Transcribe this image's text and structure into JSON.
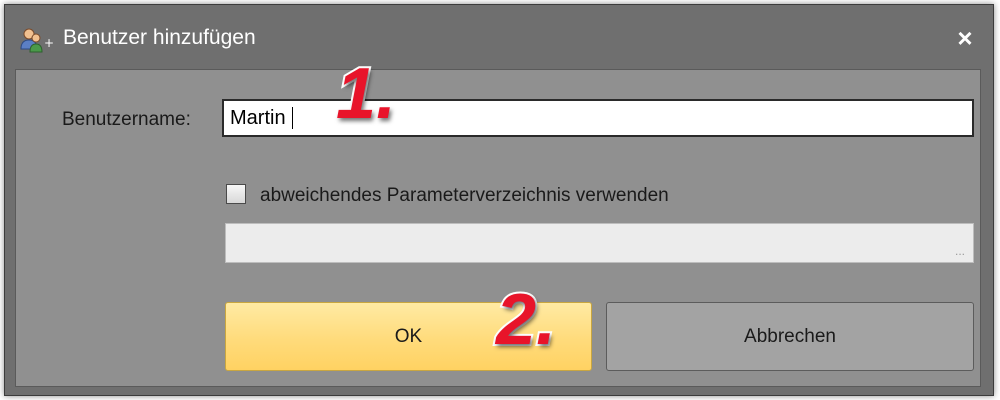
{
  "window": {
    "title": "Benutzer hinzufügen",
    "close_glyph": "×",
    "app_icon": "users-icon"
  },
  "form": {
    "username_label": "Benutzername:",
    "username_value": "Martin",
    "alt_param_dir_label": "abweichendes Parameterverzeichnis verwenden",
    "alt_param_dir_checked": false,
    "param_dir_value": "",
    "browse_glyph": "..."
  },
  "buttons": {
    "ok_label": "OK",
    "cancel_label": "Abbrechen"
  },
  "annotations": {
    "step1": "1.",
    "step2": "2."
  },
  "colors": {
    "title_bar": "#6f6f6f",
    "client_bg": "#909090",
    "ok_button": "#ffdb7b",
    "cancel_button": "#a3a3a3",
    "annotation": "#e8142a"
  }
}
